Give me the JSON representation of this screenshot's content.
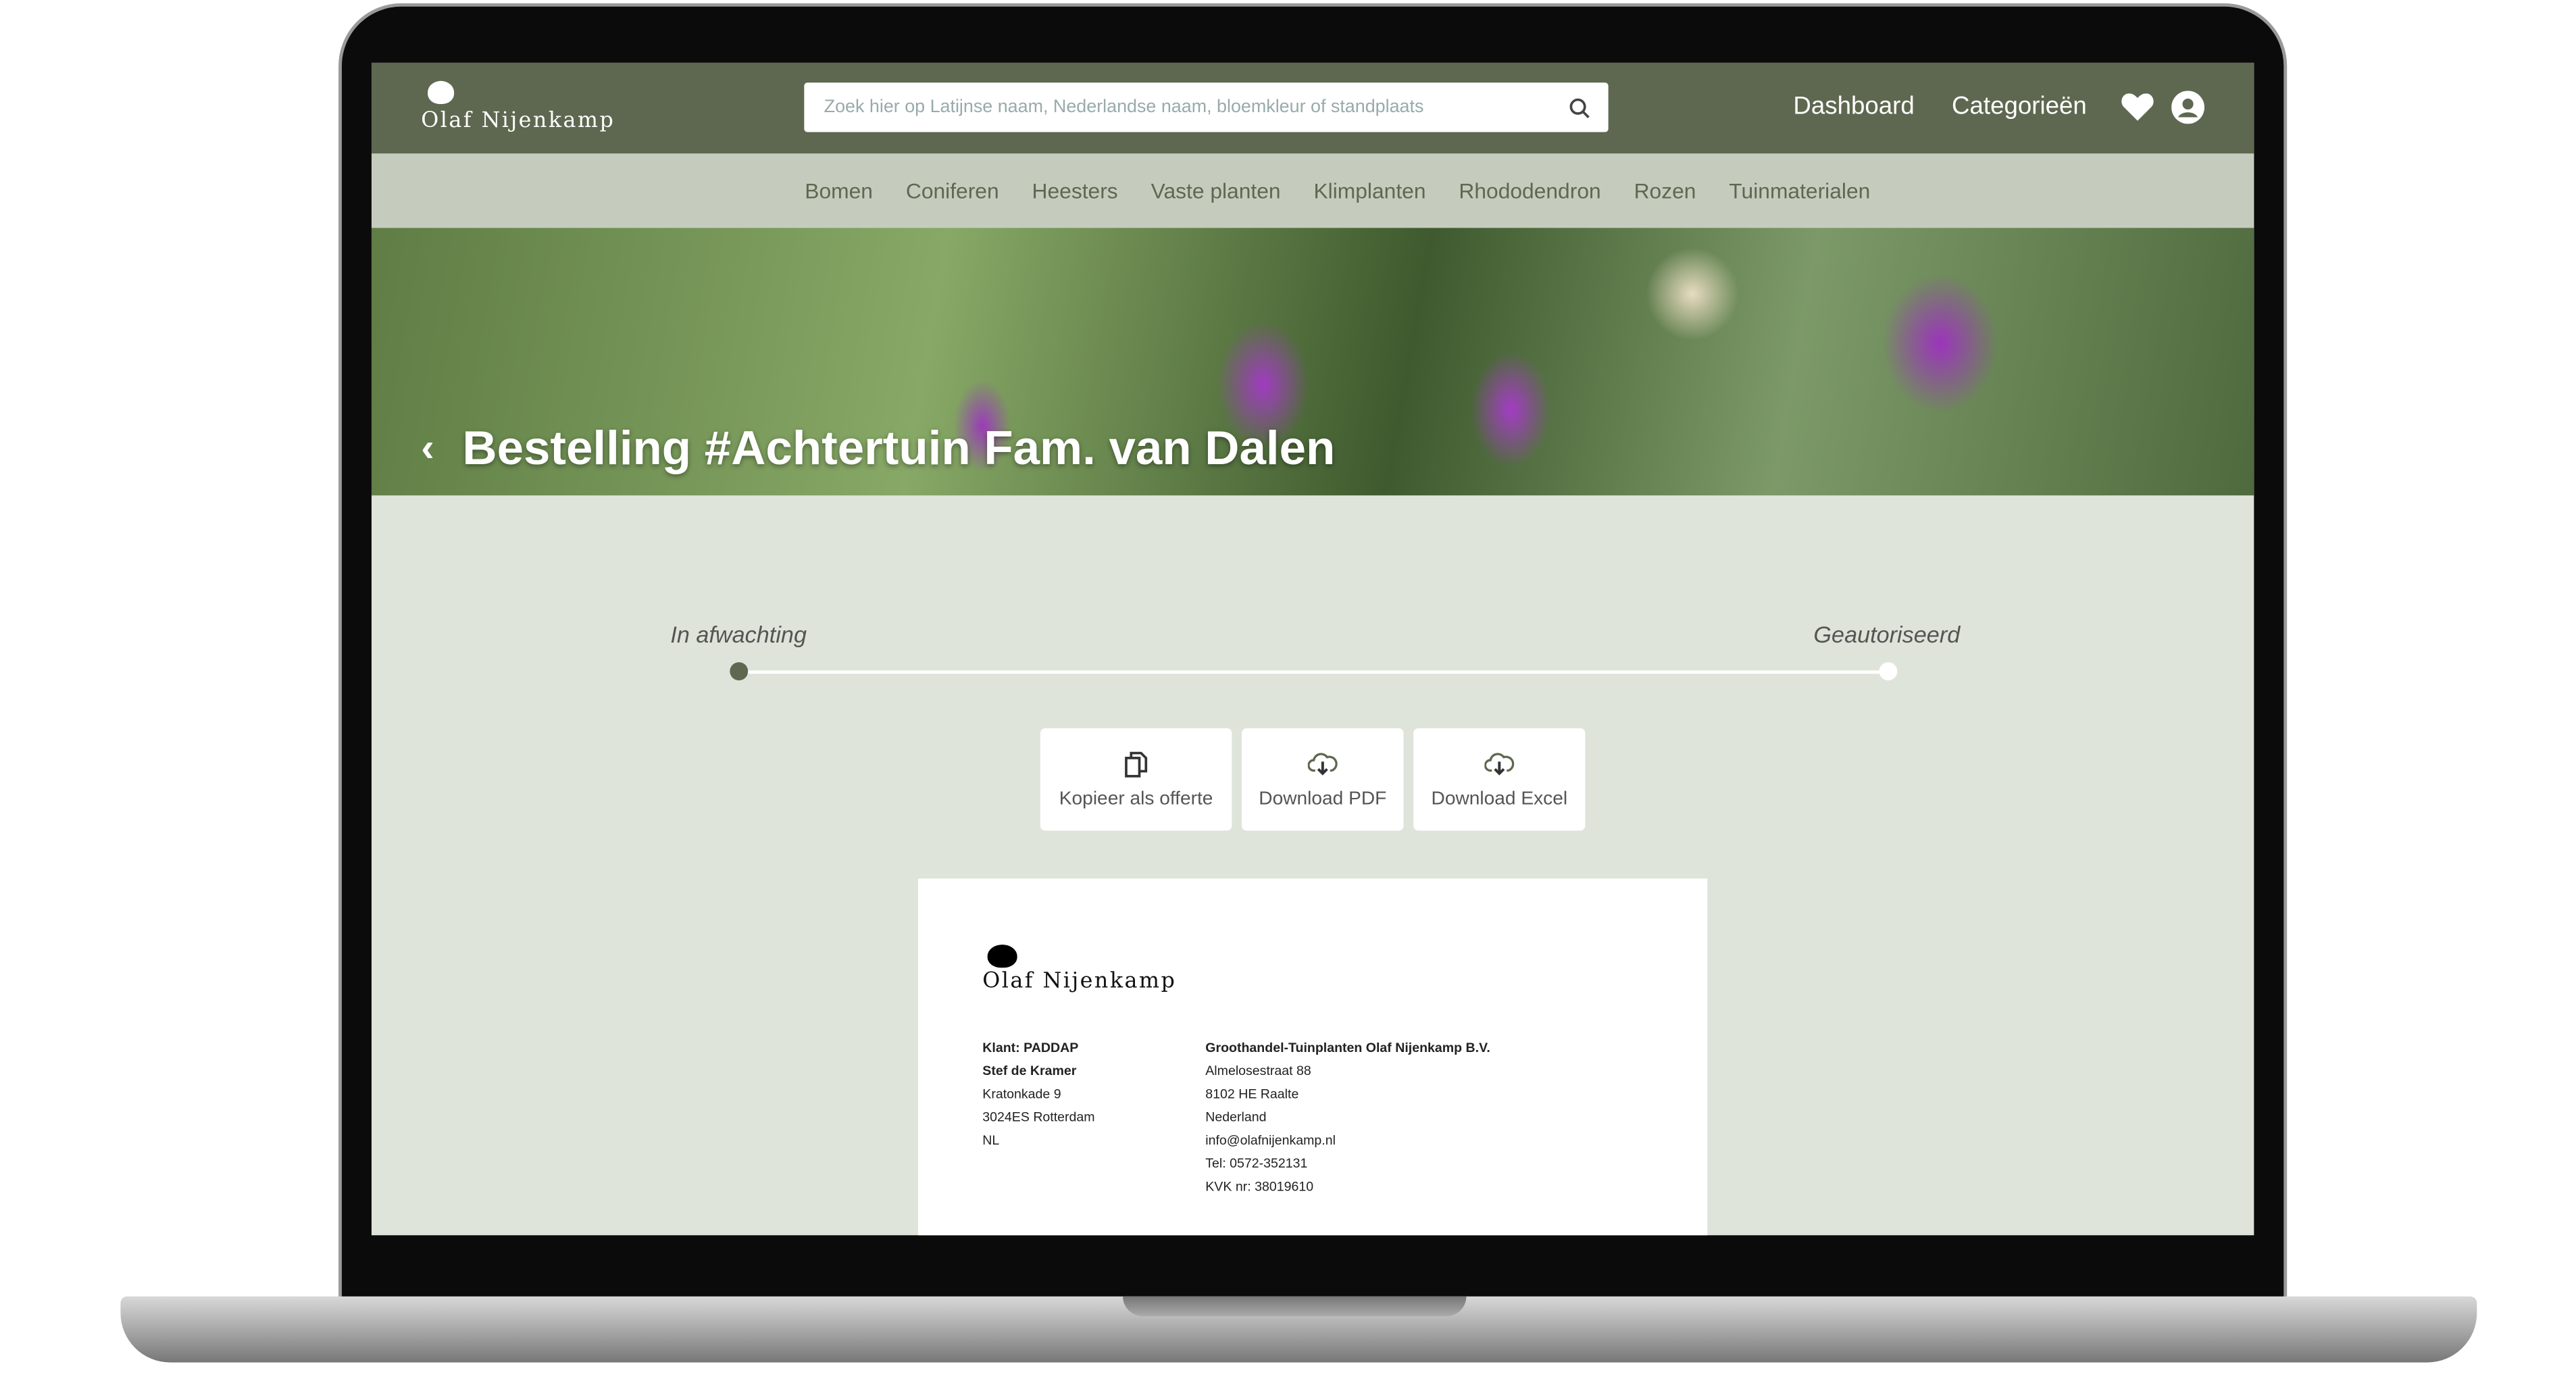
{
  "header": {
    "logo": "Olaf Nijenkamp",
    "search_placeholder": "Zoek hier op Latijnse naam, Nederlandse naam, bloemkleur of standplaats",
    "links": [
      "Dashboard",
      "Categorieën"
    ]
  },
  "nav": [
    "Bomen",
    "Coniferen",
    "Heesters",
    "Vaste planten",
    "Klimplanten",
    "Rhododendron",
    "Rozen",
    "Tuinmaterialen"
  ],
  "hero": {
    "title": "Bestelling #Achtertuin Fam. van Dalen"
  },
  "progress": {
    "start_label": "In afwachting",
    "end_label": "Geautoriseerd",
    "current_step": "In afwachting"
  },
  "actions": [
    "Kopieer als offerte",
    "Download PDF",
    "Download Excel"
  ],
  "document": {
    "logo": "Olaf Nijenkamp",
    "client": [
      "Klant: PADDAP",
      "Stef de Kramer",
      "Kratonkade 9",
      "3024ES Rotterdam",
      "NL"
    ],
    "supplier": [
      "Groothandel-Tuinplanten Olaf Nijenkamp B.V.",
      "Almelosestraat 88",
      "8102 HE Raalte",
      "Nederland",
      "info@olafnijenkamp.nl",
      "Tel: 0572-352131",
      "KVK nr: 38019610"
    ]
  },
  "colors": {
    "header": "#5e6850",
    "nav": "#c5ccbe",
    "content": "#dfe4da"
  }
}
